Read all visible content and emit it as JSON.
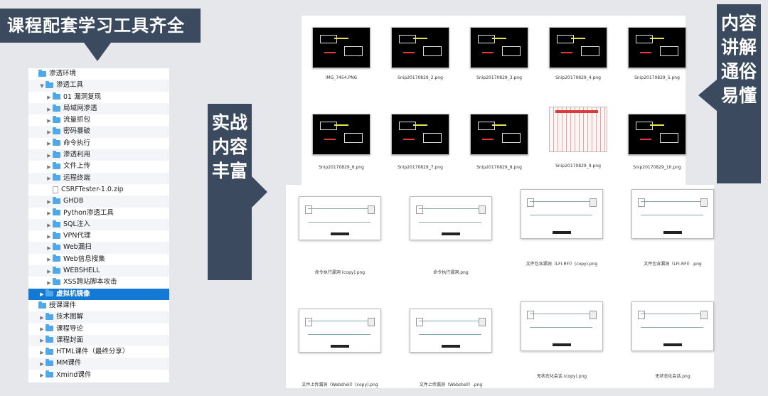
{
  "callouts": {
    "top_left": "课程配套学习工具齐全",
    "middle": "实战内容丰富",
    "right": "内容讲解通俗易懂"
  },
  "tree": {
    "rows": [
      {
        "label": "渗透环境",
        "indent": 0,
        "type": "folder",
        "tri": "",
        "alt": false,
        "selected": false
      },
      {
        "label": "渗透工具",
        "indent": 1,
        "type": "folder",
        "tri": "▼",
        "alt": true,
        "selected": false
      },
      {
        "label": "01 漏洞复现",
        "indent": 2,
        "type": "folder",
        "tri": "▶",
        "alt": false,
        "selected": false
      },
      {
        "label": "局域网渗透",
        "indent": 2,
        "type": "folder",
        "tri": "▶",
        "alt": true,
        "selected": false
      },
      {
        "label": "流量抓包",
        "indent": 2,
        "type": "folder",
        "tri": "▶",
        "alt": false,
        "selected": false
      },
      {
        "label": "密码暴破",
        "indent": 2,
        "type": "folder",
        "tri": "▶",
        "alt": true,
        "selected": false
      },
      {
        "label": "命令执行",
        "indent": 2,
        "type": "folder",
        "tri": "▶",
        "alt": false,
        "selected": false
      },
      {
        "label": "渗透利用",
        "indent": 2,
        "type": "folder",
        "tri": "▶",
        "alt": true,
        "selected": false
      },
      {
        "label": "文件上传",
        "indent": 2,
        "type": "folder",
        "tri": "▶",
        "alt": false,
        "selected": false
      },
      {
        "label": "远程终端",
        "indent": 2,
        "type": "folder",
        "tri": "▶",
        "alt": true,
        "selected": false
      },
      {
        "label": "CSRFTester-1.0.zip",
        "indent": 2,
        "type": "file",
        "tri": "",
        "alt": false,
        "selected": false
      },
      {
        "label": "GHDB",
        "indent": 2,
        "type": "folder",
        "tri": "▶",
        "alt": true,
        "selected": false
      },
      {
        "label": "Python渗透工具",
        "indent": 2,
        "type": "folder",
        "tri": "▶",
        "alt": false,
        "selected": false
      },
      {
        "label": "SQL注入",
        "indent": 2,
        "type": "folder",
        "tri": "▶",
        "alt": true,
        "selected": false
      },
      {
        "label": "VPN代理",
        "indent": 2,
        "type": "folder",
        "tri": "▶",
        "alt": false,
        "selected": false
      },
      {
        "label": "Web漏扫",
        "indent": 2,
        "type": "folder",
        "tri": "▶",
        "alt": true,
        "selected": false
      },
      {
        "label": "Web信息搜集",
        "indent": 2,
        "type": "folder",
        "tri": "▶",
        "alt": false,
        "selected": false
      },
      {
        "label": "WEBSHELL",
        "indent": 2,
        "type": "folder",
        "tri": "▶",
        "alt": true,
        "selected": false
      },
      {
        "label": "XSS跨站脚本攻击",
        "indent": 2,
        "type": "folder",
        "tri": "▶",
        "alt": false,
        "selected": false
      },
      {
        "label": "虚拟机镜像",
        "indent": 1,
        "type": "folder",
        "tri": "▶",
        "alt": false,
        "selected": true
      },
      {
        "label": "授课课件",
        "indent": 0,
        "type": "folder",
        "tri": "",
        "alt": false,
        "selected": false
      },
      {
        "label": "技术图解",
        "indent": 1,
        "type": "folder",
        "tri": "▶",
        "alt": true,
        "selected": false
      },
      {
        "label": "课程导论",
        "indent": 1,
        "type": "folder",
        "tri": "▶",
        "alt": false,
        "selected": false
      },
      {
        "label": "课程封面",
        "indent": 1,
        "type": "folder",
        "tri": "▶",
        "alt": true,
        "selected": false
      },
      {
        "label": "HTML课件（最终分享）",
        "indent": 1,
        "type": "folder",
        "tri": "▶",
        "alt": false,
        "selected": false
      },
      {
        "label": "MM课件",
        "indent": 1,
        "type": "folder",
        "tri": "▶",
        "alt": true,
        "selected": false
      },
      {
        "label": "Xmind课件",
        "indent": 1,
        "type": "folder",
        "tri": "▶",
        "alt": false,
        "selected": false
      }
    ]
  },
  "gallery_top": [
    {
      "name": "IMG_7454.PNG",
      "style": "dark"
    },
    {
      "name": "Snip20170829_2.png",
      "style": "dark"
    },
    {
      "name": "Snip20170829_3.png",
      "style": "dark"
    },
    {
      "name": "Snip20170829_4.png",
      "style": "dark"
    },
    {
      "name": "Snip20170829_5.png",
      "style": "dark"
    },
    {
      "name": "Snip20170829_6.png",
      "style": "dark"
    },
    {
      "name": "Snip20170829_7.png",
      "style": "dark"
    },
    {
      "name": "Snip20170829_8.png",
      "style": "dark"
    },
    {
      "name": "Snip20170829_9.png",
      "style": "red"
    },
    {
      "name": "Snip20170829_10.png",
      "style": "dark"
    }
  ],
  "gallery_bottom": [
    {
      "name": "命令执行漏洞 (copy).png"
    },
    {
      "name": "命令执行漏洞.png"
    },
    {
      "name": "文件包含漏洞（LFI-RFI）(copy).png"
    },
    {
      "name": "文件包含漏洞（LFI-RFI）.png"
    },
    {
      "name": "文件上传漏洞（Webshell）(copy).png"
    },
    {
      "name": "文件上传漏洞（Webshell）.png"
    },
    {
      "name": "无状态化会话 (copy).png"
    },
    {
      "name": "无状态化会话.png"
    }
  ]
}
